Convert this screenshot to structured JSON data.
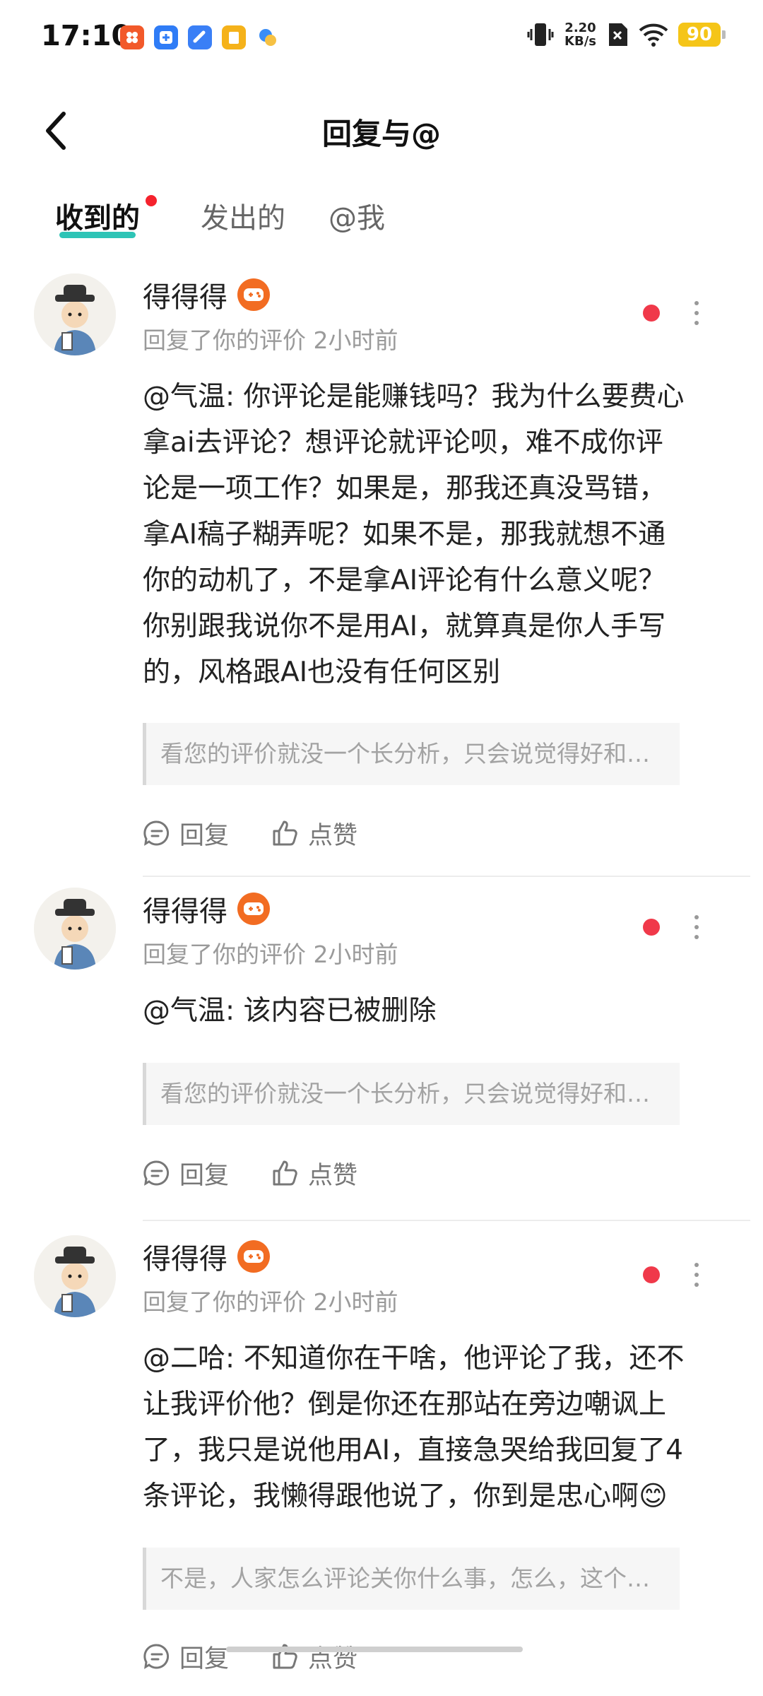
{
  "status_bar": {
    "time": "17:10",
    "net_speed_value": "2.20",
    "net_speed_unit": "KB/s",
    "battery": "90",
    "app_icons": [
      "app-orange-icon",
      "app-blue-plus-icon",
      "app-blue-icon",
      "app-yellow-note-icon",
      "app-cloud-icon"
    ]
  },
  "header": {
    "title": "回复与@",
    "back_icon": "chevron-left-icon"
  },
  "tabs": [
    {
      "label": "收到的",
      "active": true,
      "has_dot": true
    },
    {
      "label": "发出的",
      "active": false
    },
    {
      "label": "@我",
      "active": false
    }
  ],
  "comments": [
    {
      "username": "得得得",
      "subtitle": "回复了你的评价 2小时前",
      "lines": [
        "@气温: 你评论是能赚钱吗？我为什么要费心",
        "拿ai去评论？想评论就评论呗，难不成你评",
        "论是一项工作？如果是，那我还真没骂错，",
        "拿AI稿子糊弄呢？如果不是，那我就想不通",
        "你的动机了，不是拿AI评论有什么意义呢？",
        "你别跟我说你不是用AI，就算真是你人手写",
        "的，风格跟AI也没有任何区别"
      ],
      "quote": "看您的评价就没一个长分析，只会说觉得好和…",
      "reply_label": "回复",
      "like_label": "点赞"
    },
    {
      "username": "得得得",
      "subtitle": "回复了你的评价 2小时前",
      "lines": [
        "@气温: 该内容已被删除"
      ],
      "quote": "看您的评价就没一个长分析，只会说觉得好和…",
      "reply_label": "回复",
      "like_label": "点赞"
    },
    {
      "username": "得得得",
      "subtitle": "回复了你的评价 2小时前",
      "lines": [
        "@二哈: 不知道你在干啥，他评论了我，还不",
        "让我评价他？倒是你还在那站在旁边嘲讽上",
        "了，我只是说他用AI，直接急哭给我回复了4",
        "条评论，我懒得跟他说了，你到是忠心啊😊"
      ],
      "quote": "不是，人家怎么评论关你什么事，怎么，这个…",
      "reply_label": "回复",
      "like_label": "点赞"
    }
  ],
  "colors": {
    "accent_underline": "#2ec4b6",
    "unread_dot": "#f0394a",
    "badge": "#f26c22",
    "battery": "#f5c518"
  }
}
